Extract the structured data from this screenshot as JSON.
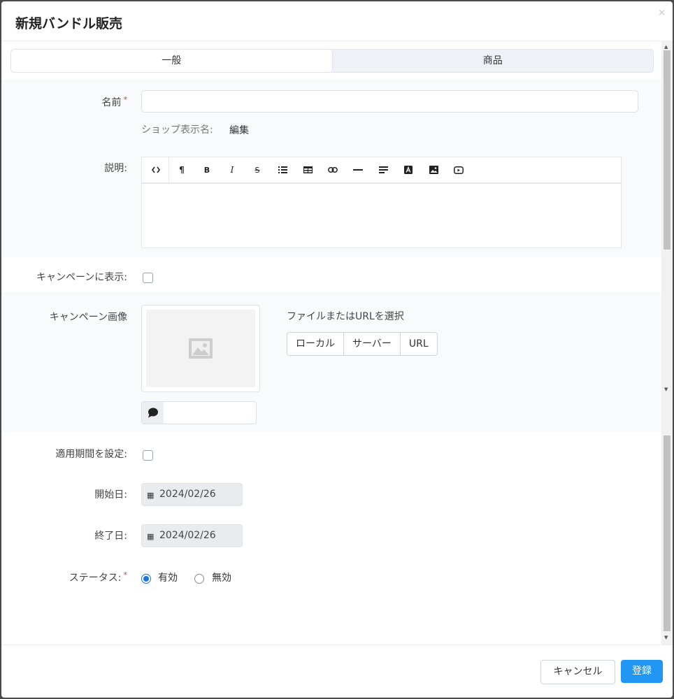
{
  "modal": {
    "title": "新規バンドル販売",
    "close_glyph": "×"
  },
  "tabs": [
    {
      "label": "一般",
      "active": true
    },
    {
      "label": "商品",
      "active": false
    }
  ],
  "form": {
    "name": {
      "label": "名前",
      "required_mark": "*",
      "value": ""
    },
    "shop_display": {
      "label": "ショップ表示名:",
      "link": "編集"
    },
    "description": {
      "label": "説明:",
      "toolbar": [
        "code-icon",
        "paragraph-icon",
        "bold-icon",
        "italic-icon",
        "strikethrough-icon",
        "list-icon",
        "table-icon",
        "link-icon",
        "horizontal-rule-icon",
        "align-icon",
        "font-color-icon",
        "image-icon",
        "video-icon"
      ],
      "toolbar_text": {
        "paragraph": "¶",
        "bold": "B",
        "italic": "I",
        "strike": "S"
      },
      "value": ""
    },
    "show_in_campaign": {
      "label": "キャンペーンに表示:",
      "checked": false
    },
    "campaign_image": {
      "label": "キャンペーン画像",
      "hint": "ファイルまたはURLを選択",
      "buttons": [
        "ローカル",
        "サーバー",
        "URL"
      ],
      "caption_value": ""
    },
    "set_period": {
      "label": "適用期間を設定:",
      "checked": false
    },
    "start_date": {
      "label": "開始日:",
      "value": "2024/02/26"
    },
    "end_date": {
      "label": "終了日:",
      "value": "2024/02/26"
    },
    "status": {
      "label": "ステータス:",
      "required_mark": "*",
      "options": [
        {
          "label": "有効",
          "checked": true
        },
        {
          "label": "無効",
          "checked": false
        }
      ]
    }
  },
  "footer": {
    "cancel": "キャンセル",
    "submit": "登録"
  },
  "colors": {
    "primary": "#2196f3",
    "required": "#e53935",
    "radio_checked": "#1a73e8"
  }
}
